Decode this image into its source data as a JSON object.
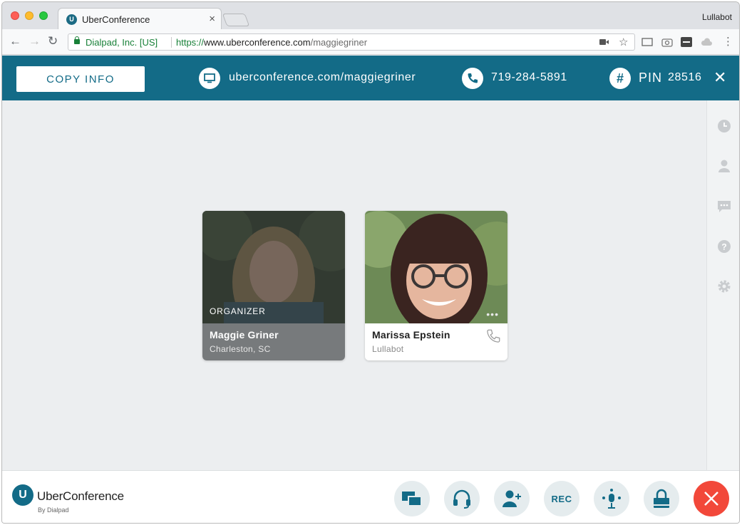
{
  "browser": {
    "tab_title": "UberConference",
    "tab_favicon_letter": "U",
    "profile_name": "Lullabot",
    "secure_label": "Dialpad, Inc. [US]",
    "url_scheme": "https://",
    "url_host": "www.uberconference.com",
    "url_path": "/maggiegriner"
  },
  "infobar": {
    "copy_label": "COPY INFO",
    "conference_url": "uberconference.com/maggiegriner",
    "phone_number": "719-284-5891",
    "pin_label": "PIN",
    "pin_value": "28516",
    "hash_symbol": "#"
  },
  "participants": [
    {
      "name": "Maggie Griner",
      "location": "Charleston, SC",
      "role": "ORGANIZER"
    },
    {
      "name": "Marissa Epstein",
      "location": "Lullabot",
      "more": "•••"
    }
  ],
  "footer": {
    "logo_letter": "U",
    "brand": "UberConference",
    "brand_sub": "By Dialpad",
    "rec_label": "REC"
  },
  "colors": {
    "brand": "#136b87",
    "hangup": "#f2483a",
    "stage": "#eceef0"
  }
}
